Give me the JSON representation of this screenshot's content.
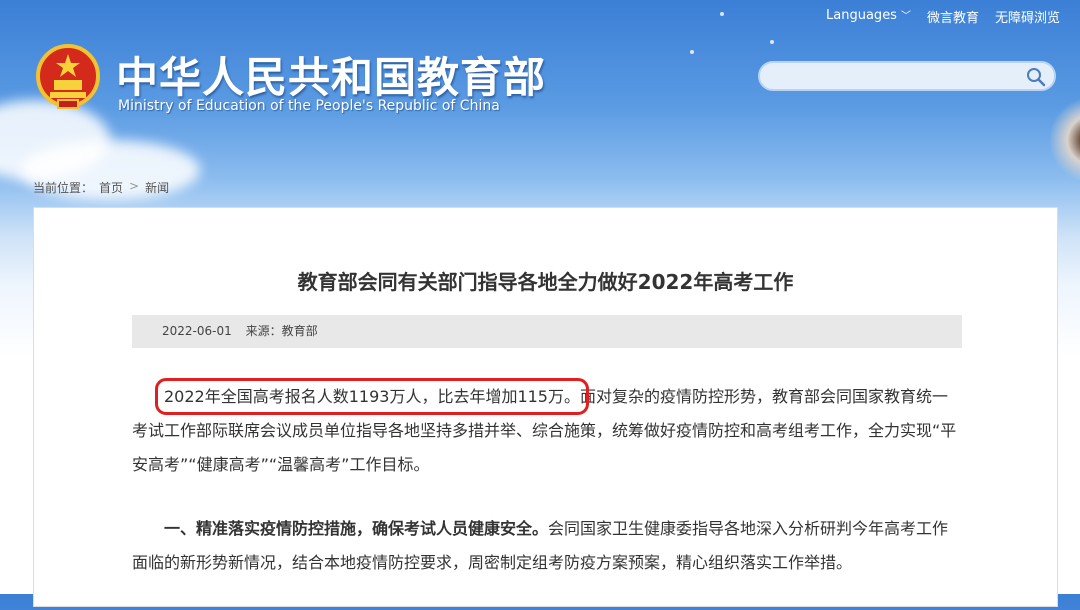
{
  "top_links": {
    "languages": "Languages",
    "weiyan": "微言教育",
    "accessibility": "无障碍浏览"
  },
  "header": {
    "title_cn": "中华人民共和国教育部",
    "title_en": "Ministry of Education of the People's Republic of China"
  },
  "search": {
    "placeholder": ""
  },
  "breadcrumb": {
    "label": "当前位置：",
    "home": "首页",
    "current": "新闻",
    "sep": ">"
  },
  "article": {
    "title": "教育部会同有关部门指导各地全力做好2022年高考工作",
    "date": "2022-06-01",
    "source": "来源：教育部",
    "p1_highlight": "2022年全国高考报名人数1193万人，比去年增加115万。",
    "p1_rest": "面对复杂的疫情防控形势，教育部会同国家教育统一考试工作部际联席会议成员单位指导各地坚持多措并举、综合施策，统筹做好疫情防控和高考组考工作，全力实现“平安高考”“健康高考”“温馨高考”工作目标。",
    "p2_bold": "一、精准落实疫情防控措施，确保考试人员健康安全。",
    "p2_rest": "会同国家卫生健康委指导各地深入分析研判今年高考工作面临的新形势新情况，结合本地疫情防控要求，周密制定组考防疫方案预案，精心组织落实工作举措。"
  },
  "colors": {
    "highlight_box": "#e02020",
    "sky": "#3b7fd6"
  }
}
